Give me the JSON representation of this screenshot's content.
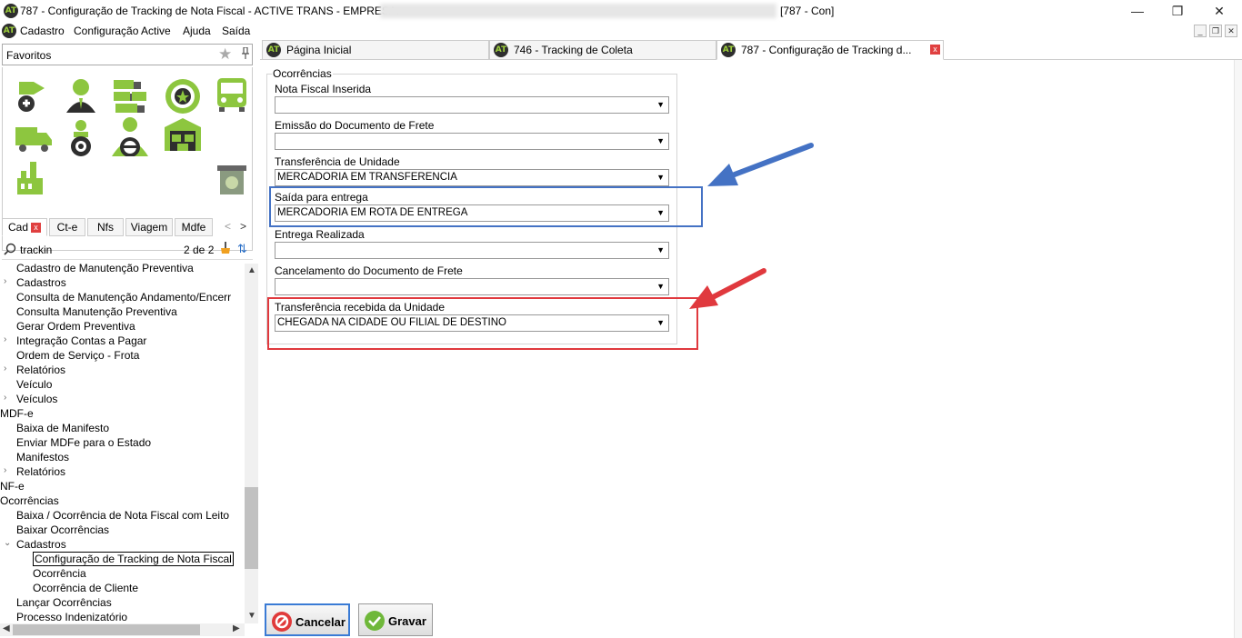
{
  "window": {
    "title": "787 - Configuração de Tracking de Nota Fiscal - ACTIVE TRANS - EMPRESA:",
    "title_suffix": "[787 - Con]",
    "app_icon_text": "AT",
    "minimize": "—",
    "restore": "❐",
    "close": "✕"
  },
  "menu": {
    "items": [
      "Cadastro",
      "Configuração Active",
      "Ajuda",
      "Saída"
    ],
    "mdi_min": "_",
    "mdi_restore": "❐",
    "mdi_close": "✕"
  },
  "sidebar": {
    "favorites_label": "Favoritos",
    "star": "★",
    "pin": "📌",
    "icons": [
      "add-vehicle-icon",
      "user-icon",
      "truck-fleet-icon",
      "wheel-icon",
      "bus-icon",
      "delivery-truck-icon",
      "driver-icon",
      "driver-wheel-icon",
      "warehouse-icon",
      "factory-icon",
      "recycle-bin-icon"
    ],
    "subtabs": [
      "Cad",
      "Ct-e",
      "Nfs",
      "Viagem",
      "Mdfe"
    ],
    "subtab_close": "x",
    "nav_prev": "<",
    "nav_next": ">",
    "search_icon": "⚲",
    "search_value": "trackin",
    "search_count": "2 de 2",
    "sort_icon": "⇅",
    "tree": [
      {
        "label": "Cadastro de Manutenção Preventiva",
        "indent": 18,
        "chev": ""
      },
      {
        "label": "Cadastros",
        "indent": 18,
        "chev": "›"
      },
      {
        "label": "Consulta de Manutenção Andamento/Encerr",
        "indent": 18,
        "chev": ""
      },
      {
        "label": "Consulta Manutenção Preventiva",
        "indent": 18,
        "chev": ""
      },
      {
        "label": "Gerar Ordem Preventiva",
        "indent": 18,
        "chev": ""
      },
      {
        "label": "Integração Contas a Pagar",
        "indent": 18,
        "chev": "›"
      },
      {
        "label": "Ordem de Serviço - Frota",
        "indent": 18,
        "chev": ""
      },
      {
        "label": "Relatórios",
        "indent": 18,
        "chev": "›"
      },
      {
        "label": "Veículo",
        "indent": 18,
        "chev": ""
      },
      {
        "label": "Veículos",
        "indent": 18,
        "chev": "›"
      },
      {
        "label": "MDF-e",
        "indent": 0,
        "chev": ""
      },
      {
        "label": "Baixa de Manifesto",
        "indent": 18,
        "chev": ""
      },
      {
        "label": "Enviar MDFe para o Estado",
        "indent": 18,
        "chev": ""
      },
      {
        "label": "Manifestos",
        "indent": 18,
        "chev": ""
      },
      {
        "label": "Relatórios",
        "indent": 18,
        "chev": "›"
      },
      {
        "label": "NF-e",
        "indent": 0,
        "chev": ""
      },
      {
        "label": "Ocorrências",
        "indent": 0,
        "chev": ""
      },
      {
        "label": "Baixa / Ocorrência de Nota Fiscal com Leito",
        "indent": 18,
        "chev": ""
      },
      {
        "label": "Baixar Ocorrências",
        "indent": 18,
        "chev": ""
      },
      {
        "label": "Cadastros",
        "indent": 18,
        "chev": "⌄"
      },
      {
        "label": "Configuração de Tracking de Nota Fiscal",
        "indent": 36,
        "chev": "",
        "selected": true
      },
      {
        "label": "Ocorrência",
        "indent": 36,
        "chev": ""
      },
      {
        "label": "Ocorrência de Cliente",
        "indent": 36,
        "chev": ""
      },
      {
        "label": "Lançar Ocorrências",
        "indent": 18,
        "chev": ""
      },
      {
        "label": "Processo Indenizatório",
        "indent": 18,
        "chev": ""
      }
    ]
  },
  "tabs": [
    {
      "label": "Página Inicial"
    },
    {
      "label": "746 - Tracking de Coleta"
    },
    {
      "label": "787 - Configuração de Tracking d...",
      "close": "x"
    }
  ],
  "form": {
    "group_label": "Ocorrências",
    "fields": [
      {
        "label": "Nota Fiscal Inserida",
        "value": ""
      },
      {
        "label": "Emissão do Documento de Frete",
        "value": ""
      },
      {
        "label": "Transferência de Unidade",
        "value": "MERCADORIA EM TRANSFERENCIA"
      },
      {
        "label": "Saída para entrega",
        "value": "MERCADORIA EM ROTA DE ENTREGA"
      },
      {
        "label": "Entrega Realizada",
        "value": ""
      },
      {
        "label": "Cancelamento do Documento de Frete",
        "value": ""
      },
      {
        "label": "Transferência recebida da Unidade",
        "value": "CHEGADA NA CIDADE OU FILIAL DE DESTINO"
      }
    ],
    "dropdown_arrow": "▼"
  },
  "buttons": {
    "cancel_label": "Cancelar",
    "save_label": "Gravar"
  },
  "colors": {
    "highlight_blue": "#4472c4",
    "highlight_red": "#e0393e",
    "icon_green": "#8dc63f"
  }
}
